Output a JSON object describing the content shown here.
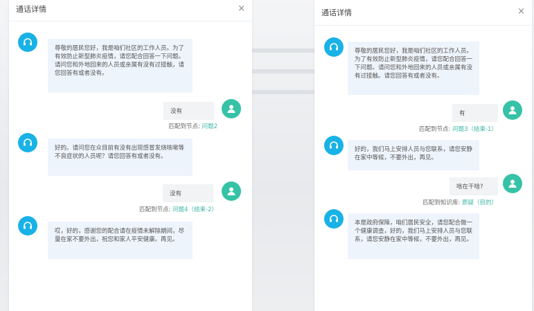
{
  "left": {
    "title": "通话详情",
    "close_icon": "×",
    "messages": [
      {
        "role": "bot",
        "text": "尊敬的居民您好，我是咱们社区的工作人员。为了有效防止新型肺炎疫情，请您配合回答一下问题。请问您和外地回来的人员或亲属有没有过接触，请您回答有或者没有。"
      },
      {
        "role": "user",
        "text": "没有",
        "meta_label": "匹配到节点:",
        "meta_link": "问题2"
      },
      {
        "role": "bot",
        "text": "好的。请问您在众目前有没有出现感冒发烧咳嗽等不良症状的人员呢？请您回答有或者没有。"
      },
      {
        "role": "user",
        "text": "没有",
        "meta_label": "匹配到节点:",
        "meta_link": "问题4（结束-2）"
      },
      {
        "role": "bot",
        "text": "哎，好的，感谢您的配合请在疫情未解除期间，尽量在家不要外出，祝您和家人平安健康。再见。"
      }
    ]
  },
  "right": {
    "title": "通话详情",
    "close_icon": "×",
    "messages": [
      {
        "role": "bot",
        "text": "尊敬的居民您好，我是咱们社区的工作人员。为了有效防止新型肺炎疫情，请您配合回答一下问题。请问您和外地回来的人员或亲属有没有过接触。请您回答有或者没有。"
      },
      {
        "role": "user",
        "text": "有",
        "meta_label": "匹配到节点:",
        "meta_link": "问题3（结束-1）"
      },
      {
        "role": "bot",
        "text": "好的，我们马上安排人员与您联系，请您安静在家中等候，不要外出，再见。"
      },
      {
        "role": "user",
        "text": "啥在干啥?",
        "meta_label": "匹配到知识库:",
        "meta_link": "质疑（目的）"
      },
      {
        "role": "bot",
        "text": "本是政府保障，咱们居民安全，请您配合做一个健康调查，好的，我们马上安排人员与您联系，请您安静在家中等候，不要外出，再见。"
      }
    ]
  },
  "colors": {
    "bot_avatar": "#19b2e6",
    "user_avatar": "#36c2a6",
    "link": "#3bb5a5"
  },
  "icons": {
    "bot": "headset-icon",
    "user": "person-icon",
    "close": "close-icon"
  }
}
